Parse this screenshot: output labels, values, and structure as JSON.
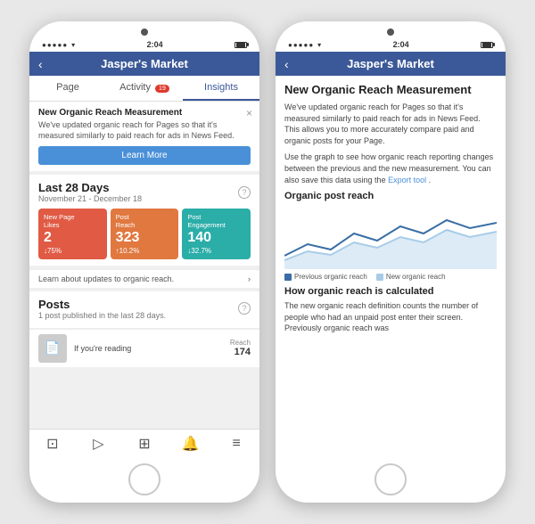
{
  "left_phone": {
    "status": {
      "time": "2:04",
      "signal_bars": [
        3,
        5,
        7,
        9,
        11
      ],
      "wifi": "▾",
      "battery_full": true
    },
    "nav": {
      "back_icon": "‹",
      "title": "Jasper's Market"
    },
    "tabs": [
      {
        "id": "page",
        "label": "Page",
        "active": false
      },
      {
        "id": "activity",
        "label": "Activity",
        "badge": "19",
        "active": false
      },
      {
        "id": "insights",
        "label": "Insights",
        "active": true
      }
    ],
    "notification": {
      "title": "New Organic Reach Measurement",
      "body": "We've updated organic reach for Pages so that it's measured similarly to paid reach for ads in News Feed.",
      "learn_more": "Learn More",
      "close": "×"
    },
    "stats_section": {
      "title": "Last 28 Days",
      "subtitle": "November 21 - December 18",
      "help": "?",
      "cards": [
        {
          "label": "New Page Likes",
          "value": "2",
          "change": "↓75%",
          "direction": "down",
          "color": "red"
        },
        {
          "label": "Post Reach",
          "value": "323",
          "change": "↑10.2%",
          "direction": "up",
          "color": "orange"
        },
        {
          "label": "Post Engagement",
          "value": "140",
          "change": "↓32.7%",
          "direction": "down",
          "color": "teal"
        }
      ],
      "link": "Learn about updates to organic reach."
    },
    "posts_section": {
      "title": "Posts",
      "subtitle": "1 post published in the last 28 days.",
      "help": "?",
      "item": {
        "text": "If you're reading",
        "reach_label": "Reach",
        "reach_value": "174"
      }
    },
    "bottom_nav": [
      {
        "icon": "⊡",
        "active": false
      },
      {
        "icon": "▷",
        "active": false
      },
      {
        "icon": "⊞",
        "active": false
      },
      {
        "icon": "🔔",
        "active": false
      },
      {
        "icon": "≡",
        "active": false
      }
    ]
  },
  "right_phone": {
    "status": {
      "time": "2:04"
    },
    "nav": {
      "back_icon": "‹",
      "title": "Jasper's Market"
    },
    "detail": {
      "title": "New Organic Reach Measurement",
      "para1": "We've updated organic reach for Pages so that it's measured similarly to paid reach for ads in News Feed. This allows you to more accurately compare paid and organic posts for your Page.",
      "para2": "Use the graph to see how organic reach reporting changes between the previous and the new measurement. You can also save this data using the",
      "export_link": "Export tool",
      "para2_end": ".",
      "chart_label": "Organic post reach",
      "legend": [
        {
          "color": "dark",
          "label": "Previous organic reach"
        },
        {
          "color": "light",
          "label": "New organic reach"
        }
      ],
      "how_title": "How organic reach is calculated",
      "how_para": "The new organic reach definition counts the number of people who had an unpaid post enter their screen. Previously organic reach was"
    }
  },
  "chart_data": {
    "previous": [
      20,
      35,
      28,
      45,
      38,
      55,
      42,
      60,
      48,
      55
    ],
    "new_reach": [
      15,
      25,
      22,
      35,
      30,
      42,
      36,
      50,
      40,
      48
    ]
  }
}
